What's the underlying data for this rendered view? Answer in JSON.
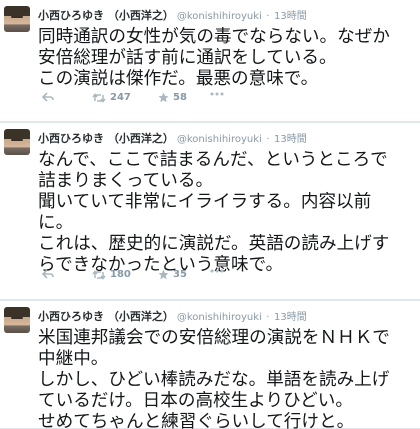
{
  "tweets": [
    {
      "name": "小西ひろゆき （小西洋之）",
      "handle": "@konishihiroyuki",
      "time": "13時間",
      "lines": [
        "同時通訳の女性が気の毒でならない。なぜか",
        "安倍総理が話す前に通訳をしている。",
        "この演説は傑作だ。最悪の意味で。"
      ],
      "retweets": "247",
      "favorites": "58"
    },
    {
      "name": "小西ひろゆき （小西洋之）",
      "handle": "@konishihiroyuki",
      "time": "13時間",
      "lines": [
        "なんで、ここで詰まるんだ、というところで",
        "詰まりまくっている。",
        "聞いていて非常にイライラする。内容以前",
        "に。",
        "これは、歴史的に演説だ。英語の読み上げす",
        "らできなかったという意味で。"
      ],
      "retweets": "180",
      "favorites": "35"
    },
    {
      "name": "小西ひろゆき （小西洋之）",
      "handle": "@konishihiroyuki",
      "time": "13時間",
      "lines": [
        "米国連邦議会での安倍総理の演説をＮＨＫで",
        "中継中。",
        "しかし、ひどい棒読みだな。単語を読み上げ",
        "ているだけ。日本の高校生よりひどい。",
        "せめてちゃんと練習ぐらいして行けと。"
      ]
    }
  ],
  "separator": "·",
  "icons": [
    "reply-icon",
    "retweet-icon",
    "favorite-icon",
    "more-icon"
  ],
  "colors": {
    "muted": "#8899a6",
    "text": "#14171a",
    "border": "#e1e8ed"
  }
}
